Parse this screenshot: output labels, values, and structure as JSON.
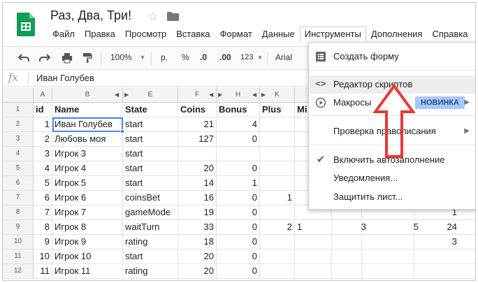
{
  "app": {
    "doc_title": "Раз, Два, Три!",
    "colors": {
      "accent": "#0f9d58",
      "selection": "#4a8af4",
      "badge": "#a8c7fa",
      "arrow": "#e53935"
    }
  },
  "menubar": [
    "Файл",
    "Правка",
    "Просмотр",
    "Вставка",
    "Формат",
    "Данные",
    "Инструменты",
    "Дополнения",
    "Справка"
  ],
  "toolbar": {
    "zoom": "100%",
    "currency": "р.",
    "percent": "%",
    "dec_less": ".0",
    "dec_more": ".00",
    "format_more": "123",
    "font": "Arial"
  },
  "formula_bar": {
    "icon": "fx",
    "value": "Иван Голубев"
  },
  "columns": [
    "A",
    "B",
    "E",
    "F",
    "H",
    "K",
    "L"
  ],
  "headers": [
    "id",
    "Name",
    "State",
    "Coins",
    "Bonus",
    "Plus",
    "Mi"
  ],
  "rows": [
    {
      "n": "1",
      "cells": [
        "id",
        "Name",
        "State",
        "Coins",
        "Bonus",
        "Plus",
        "Mi"
      ]
    },
    {
      "n": "2",
      "cells": [
        "1",
        "Иван Голубев",
        "start",
        "21",
        "4",
        "",
        ""
      ]
    },
    {
      "n": "3",
      "cells": [
        "2",
        "Любовь моя",
        "start",
        "127",
        "0",
        "",
        ""
      ]
    },
    {
      "n": "4",
      "cells": [
        "3",
        "Игрок 3",
        "start",
        "",
        "",
        "",
        ""
      ]
    },
    {
      "n": "5",
      "cells": [
        "4",
        "Игрок 4",
        "start",
        "20",
        "0",
        "",
        ""
      ]
    },
    {
      "n": "6",
      "cells": [
        "5",
        "Игрок 5",
        "start",
        "14",
        "1",
        "",
        ""
      ]
    },
    {
      "n": "7",
      "cells": [
        "6",
        "Игрок 6",
        "coinsBet",
        "16",
        "0",
        "1",
        ""
      ]
    },
    {
      "n": "8",
      "cells": [
        "7",
        "Игрок 7",
        "gameMode",
        "19",
        "0",
        "",
        ""
      ]
    },
    {
      "n": "9",
      "cells": [
        "8",
        "Игрок 8",
        "waitTurn",
        "33",
        "0",
        "2",
        "1"
      ]
    },
    {
      "n": "10",
      "cells": [
        "9",
        "Игрок 9",
        "rating",
        "18",
        "0",
        "",
        ""
      ]
    },
    {
      "n": "11",
      "cells": [
        "10",
        "Игрок 10",
        "start",
        "20",
        "0",
        "",
        ""
      ]
    },
    {
      "n": "12",
      "cells": [
        "11",
        "Игрок 11",
        "rating",
        "20",
        "0",
        "",
        ""
      ]
    }
  ],
  "hidden_right": {
    "row8_col_m": "1",
    "row9": [
      "3",
      "5",
      "24"
    ],
    "row10_last": "3"
  },
  "dropdown": {
    "items": [
      {
        "label": "Создать форму",
        "icon": "form-icon"
      },
      {
        "label": "Редактор скриптов",
        "icon": "code-icon"
      },
      {
        "label": "Макросы",
        "icon": "play-icon",
        "badge": "НОВИНКА"
      },
      {
        "label": "Проверка правописания",
        "icon": ""
      },
      {
        "label": "Включить автозаполнение",
        "icon": "check-icon"
      },
      {
        "label": "Уведомления...",
        "icon": ""
      },
      {
        "label": "Защитить лист...",
        "icon": ""
      }
    ]
  }
}
